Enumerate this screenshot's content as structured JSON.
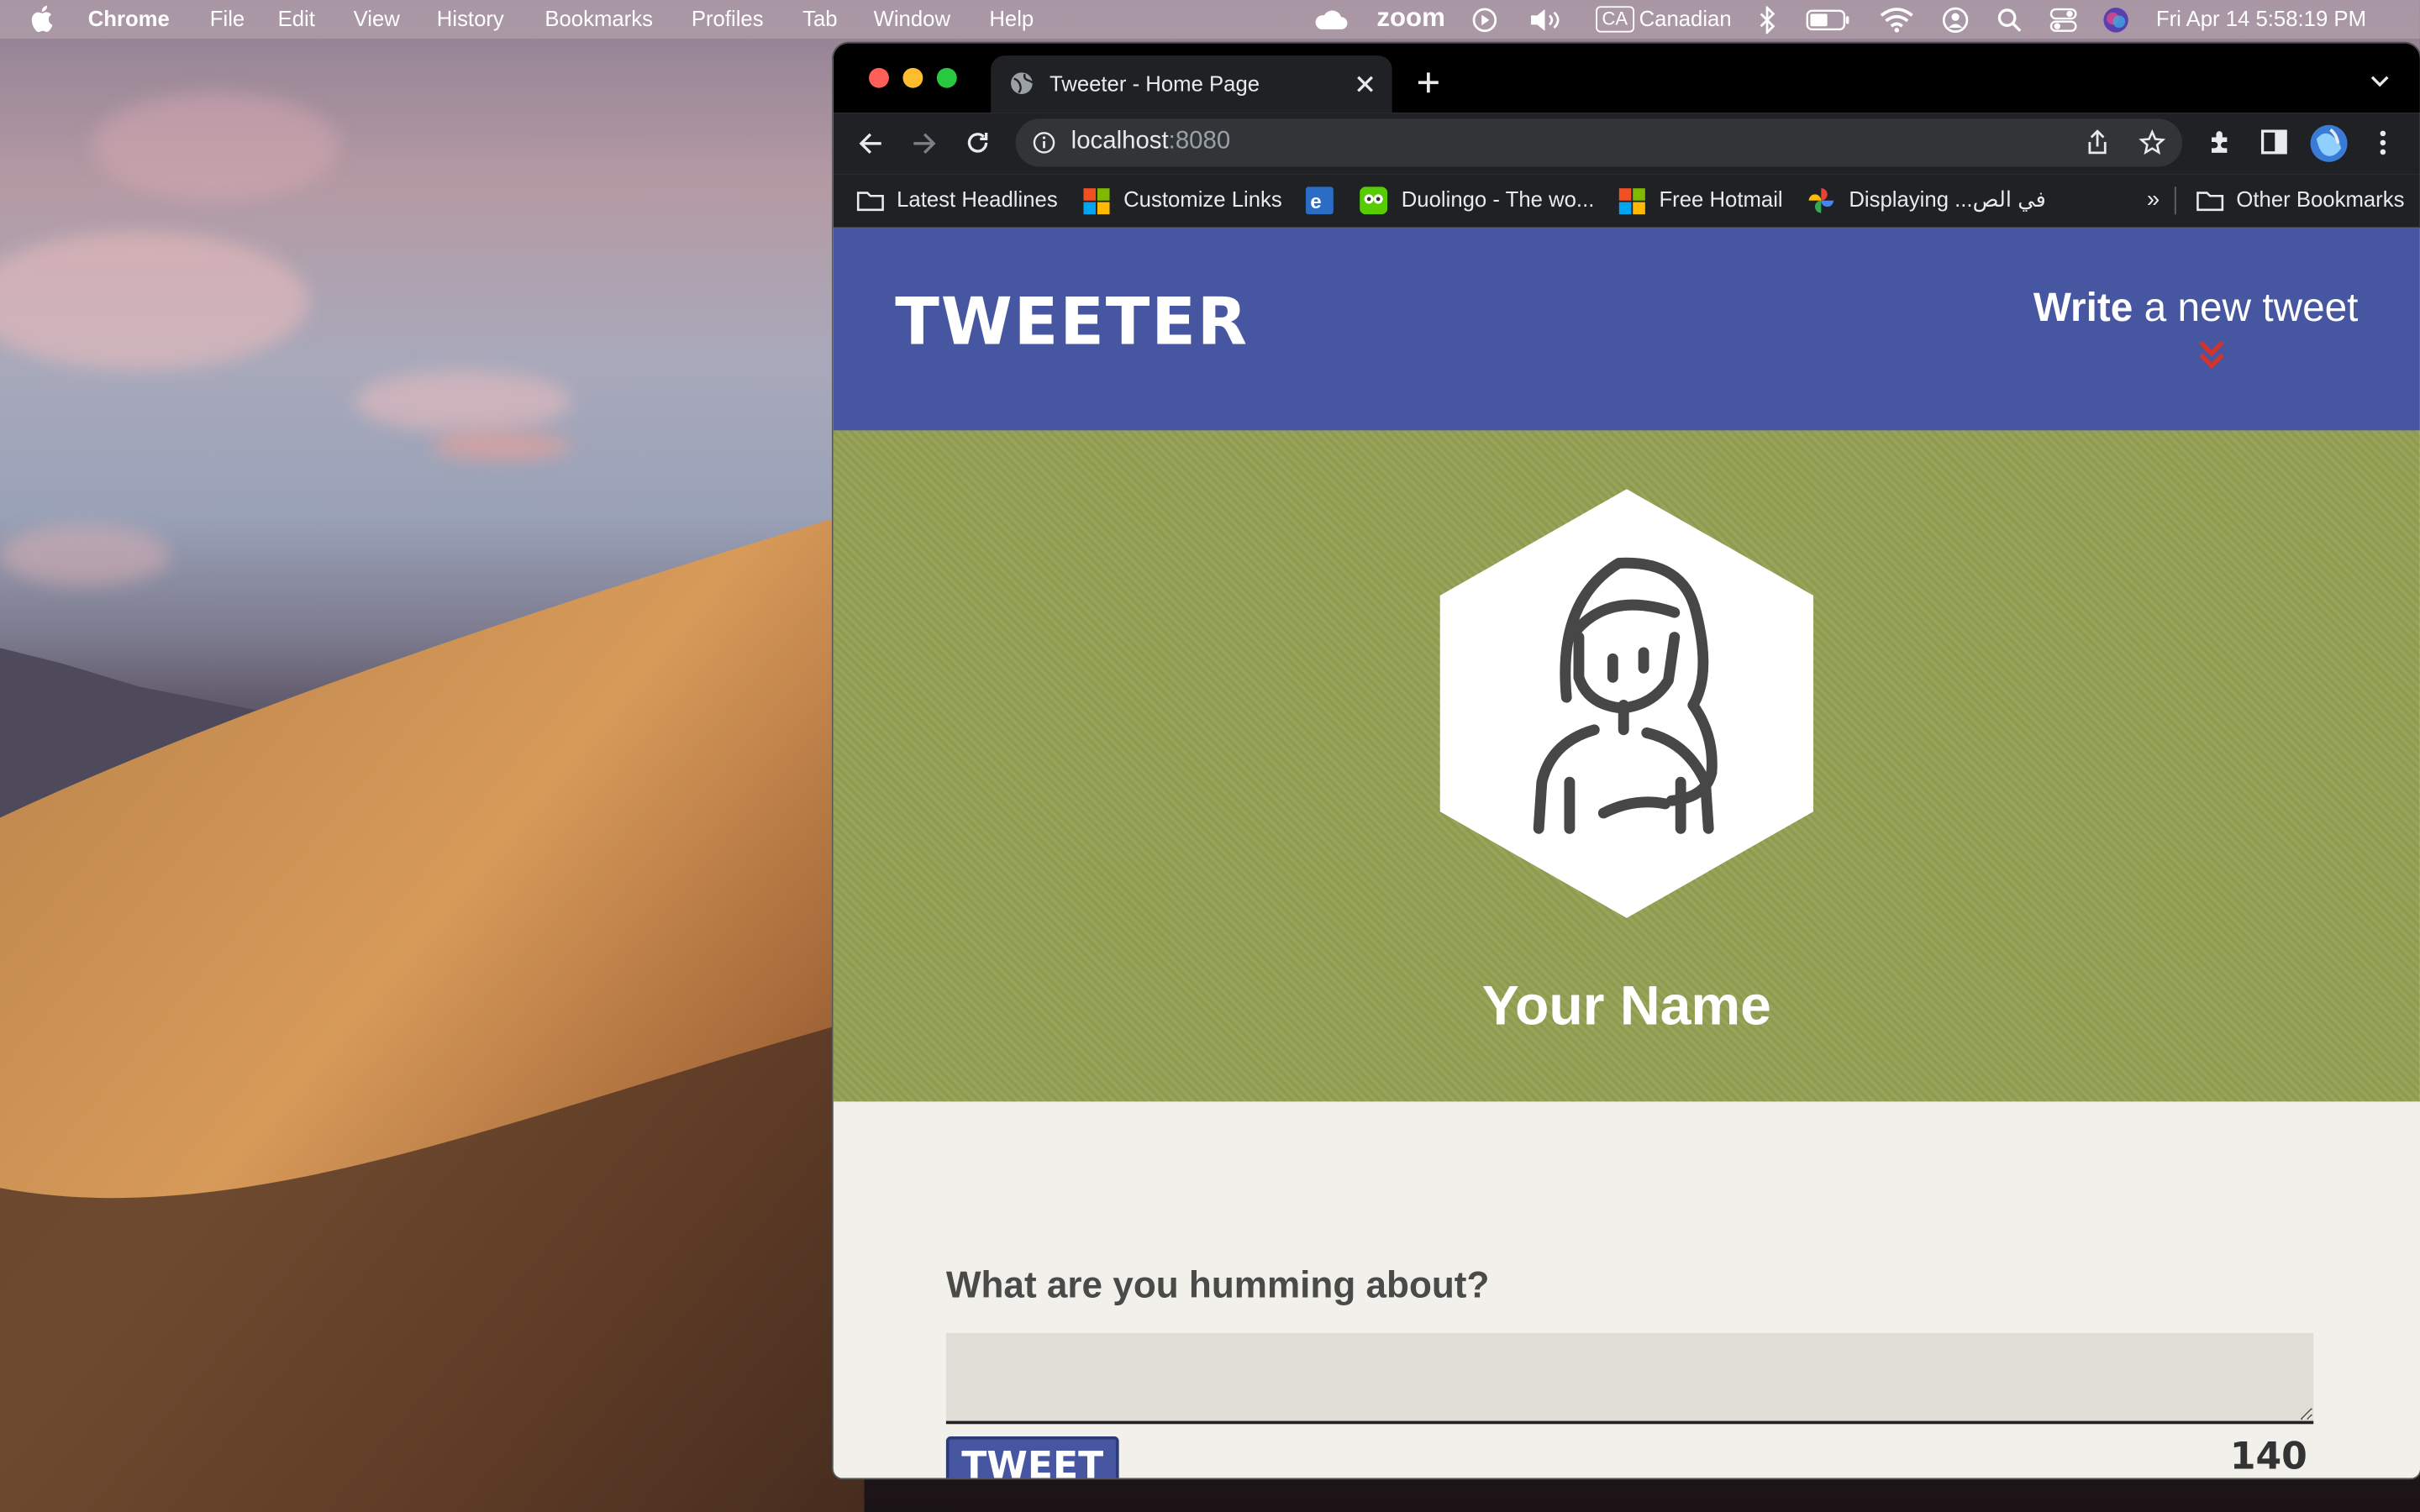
{
  "menubar": {
    "app": "Chrome",
    "items": [
      "File",
      "Edit",
      "View",
      "History",
      "Bookmarks",
      "Profiles",
      "Tab",
      "Window",
      "Help"
    ],
    "zoom": "zoom",
    "input_badge": "CA",
    "input_source": "Canadian",
    "clock": "Fri Apr 14  5:58:19 PM"
  },
  "browser": {
    "tab_title": "Tweeter - Home Page",
    "url_host": "localhost",
    "url_port": ":8080",
    "bookmarks": [
      "Latest Headlines",
      "Customize Links",
      "Duolingo - The wo...",
      "Free Hotmail",
      "Displaying ...في الص"
    ],
    "more": "»",
    "other_bookmarks": "Other Bookmarks"
  },
  "page": {
    "brand": "TWEETER",
    "write_bold": "Write",
    "write_rest": " a new tweet",
    "profile_name": "Your Name",
    "composer_label": "What are you humming about?",
    "tweet_button": "TWEET",
    "counter": "140"
  },
  "colors": {
    "nav": "#4656a0",
    "hero": "#93a052",
    "accent_red": "#d0342c"
  }
}
